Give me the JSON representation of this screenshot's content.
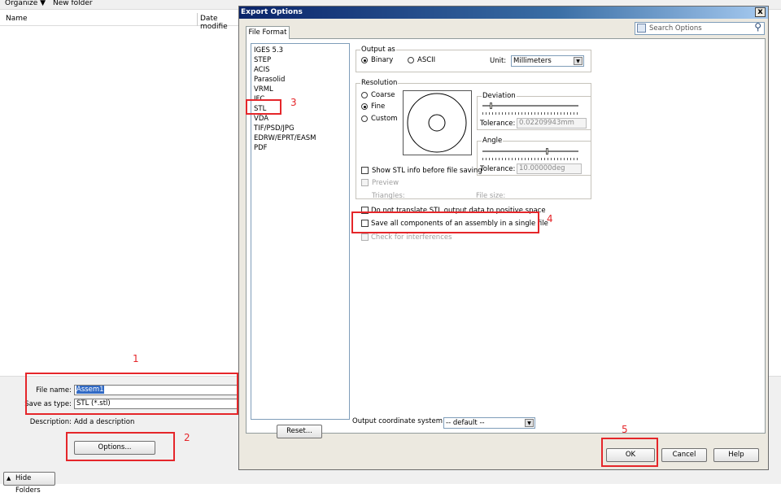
{
  "save_dialog": {
    "toolbar": {
      "organize": "Organize ▼",
      "new_folder": "New folder"
    },
    "columns": {
      "name": "Name",
      "date_modified": "Date modifie"
    },
    "file_name_label": "File name:",
    "file_name_value": "Assem1",
    "save_as_type_label": "Save as type:",
    "save_as_type_value": "STL (*.stl)",
    "description_label": "Description:",
    "description_value": "Add a description",
    "options_button": "Options...",
    "hide_folders": "Hide Folders"
  },
  "export_dialog": {
    "title": "Export Options",
    "close": "x",
    "tab": "File Format",
    "search_placeholder": "Search Options",
    "formats": [
      "IGES 5.3",
      "STEP",
      "ACIS",
      "Parasolid",
      "VRML",
      "IFC",
      "STL",
      "VDA",
      "TIF/PSD/JPG",
      "EDRW/EPRT/EASM",
      "PDF"
    ],
    "output_as": {
      "label": "Output as",
      "binary": "Binary",
      "ascii": "ASCII",
      "selected": "Binary",
      "unit_label": "Unit:",
      "unit_value": "Millimeters"
    },
    "resolution": {
      "label": "Resolution",
      "coarse": "Coarse",
      "fine": "Fine",
      "custom": "Custom",
      "selected": "Fine",
      "deviation_label": "Deviation",
      "deviation_tolerance_label": "Tolerance:",
      "deviation_tolerance_value": "0.02209943mm",
      "deviation_slider_fraction": 0.08,
      "angle_label": "Angle",
      "angle_tolerance_label": "Tolerance:",
      "angle_tolerance_value": "10.00000deg",
      "angle_slider_fraction": 0.68,
      "show_info": "Show STL info before file saving",
      "preview": "Preview",
      "triangles": "Triangles:",
      "file_size": "File size:"
    },
    "options": {
      "do_not_translate": "Do not translate STL output data to positive space",
      "save_all_components": "Save all components of an assembly in a single file",
      "check_interferences": "Check for interferences"
    },
    "output_coord_label": "Output coordinate system:",
    "output_coord_value": "-- default --",
    "reset_button": "Reset...",
    "ok_button": "OK",
    "cancel_button": "Cancel",
    "help_button": "Help"
  },
  "annotations": [
    "1",
    "2",
    "3",
    "4",
    "5"
  ],
  "colors": {
    "annotation_red": "#e5262a",
    "title_bar": "#0a246a"
  }
}
